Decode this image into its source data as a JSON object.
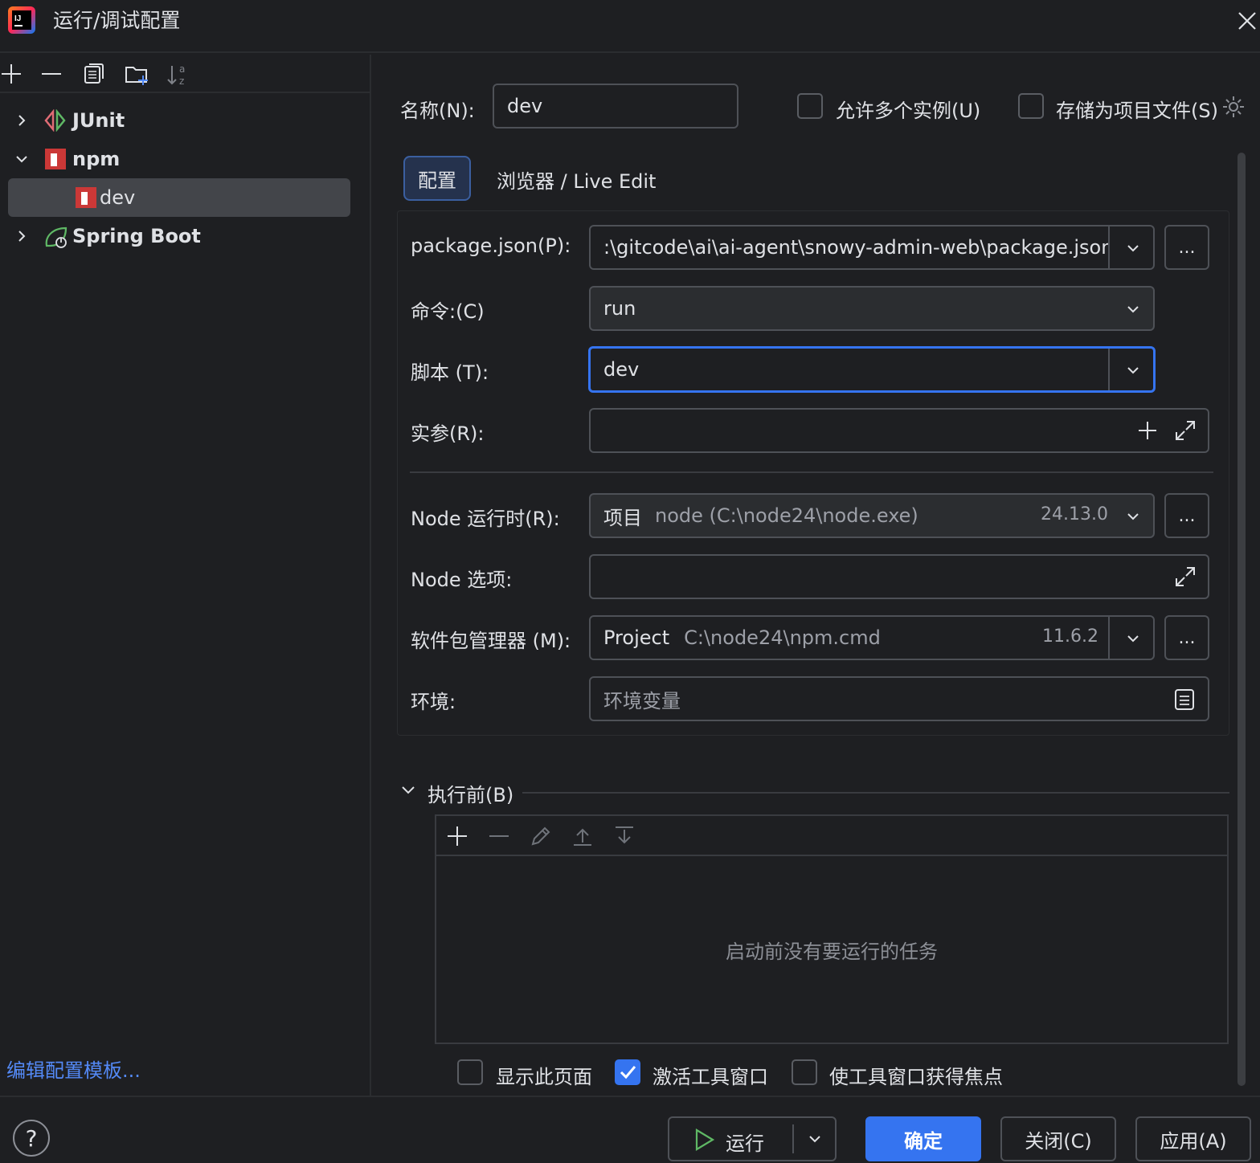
{
  "window": {
    "title": "运行/调试配置",
    "logo_icon": "intellij-idea-icon"
  },
  "toolbar": {
    "icons": [
      "plus-icon",
      "minus-icon",
      "copy-icon",
      "new-folder-icon",
      "sort-az-icon"
    ]
  },
  "tree": {
    "items": [
      {
        "label": "JUnit",
        "icon": "junit-icon",
        "expanded": false
      },
      {
        "label": "npm",
        "icon": "npm-icon",
        "expanded": true
      },
      {
        "label": "dev",
        "icon": "npm-icon",
        "selected": true
      },
      {
        "label": "Spring Boot",
        "icon": "spring-boot-icon",
        "expanded": false
      }
    ]
  },
  "left_footer": {
    "edit_templates": "编辑配置模板..."
  },
  "form": {
    "name_label": "名称(N):",
    "name_value": "dev",
    "allow_parallel_label": "允许多个实例(U)",
    "store_as_project_label": "存储为项目文件(S)",
    "tabs": [
      "配置",
      "浏览器 / Live Edit"
    ],
    "package_json_label": "package.json(P):",
    "package_json_value": ":\\gitcode\\ai\\ai-agent\\snowy-admin-web\\package.json",
    "command_label": "命令:(C)",
    "command_value": "run",
    "scripts_label": "脚本 (T):",
    "scripts_value": "dev",
    "arguments_label": "实参(R):",
    "node_runtime_label": "Node 运行时(R):",
    "node_runtime_prefix": "项目",
    "node_runtime_path": "node (C:\\node24\\node.exe)",
    "node_runtime_version": "24.13.0",
    "node_options_label": "Node 选项:",
    "package_manager_label": "软件包管理器 (M):",
    "package_manager_prefix": "Project",
    "package_manager_path": "C:\\node24\\npm.cmd",
    "package_manager_version": "11.6.2",
    "env_label": "环境:",
    "env_placeholder": "环境变量",
    "dots": "..."
  },
  "before_launch": {
    "title": "执行前(B)",
    "empty_text": "启动前没有要运行的任务",
    "options": [
      {
        "label": "显示此页面",
        "checked": false
      },
      {
        "label": "激活工具窗口",
        "checked": true
      },
      {
        "label": "使工具窗口获得焦点",
        "checked": false
      }
    ]
  },
  "buttons": {
    "help": "?",
    "run": "运行",
    "ok": "确定",
    "close": "关闭(C)",
    "apply": "应用(A)"
  },
  "colors": {
    "background": "#1e1f22",
    "accent": "#3574f0",
    "link": "#548af7"
  }
}
